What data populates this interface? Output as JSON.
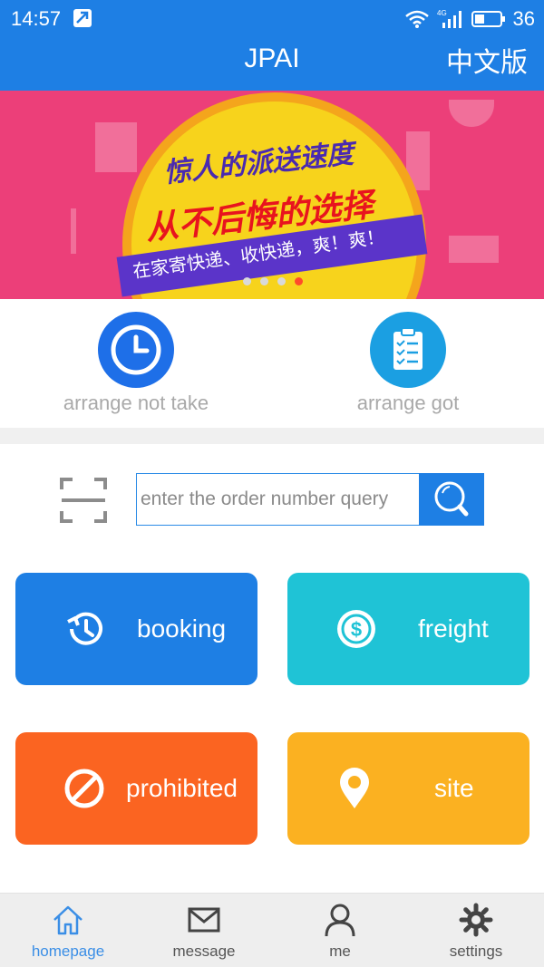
{
  "status_bar": {
    "time": "14:57",
    "network": "4G",
    "battery": "36"
  },
  "header": {
    "title": "JPAI",
    "language_switch": "中文版"
  },
  "banner": {
    "line1": "惊人的派送速度",
    "line2": "从不后悔的选择",
    "line3": "在家寄快递、收快递，爽！爽！",
    "slide_count": 4,
    "active_slide": 4
  },
  "arrange": {
    "not_take_label": "arrange not take",
    "got_label": "arrange got"
  },
  "search": {
    "placeholder": "enter the order number query",
    "value": ""
  },
  "tiles": {
    "booking": "booking",
    "freight": "freight",
    "prohibited": "prohibited",
    "site": "site"
  },
  "bottom_nav": {
    "homepage": "homepage",
    "message": "message",
    "me": "me",
    "settings": "settings"
  },
  "colors": {
    "primary": "#1e7fe4",
    "banner": "#ec3f79",
    "booking": "#1e7fe4",
    "freight": "#1fc3d6",
    "prohibited": "#fb6421",
    "site": "#fbb121",
    "active_nav": "#3a8ee6"
  }
}
